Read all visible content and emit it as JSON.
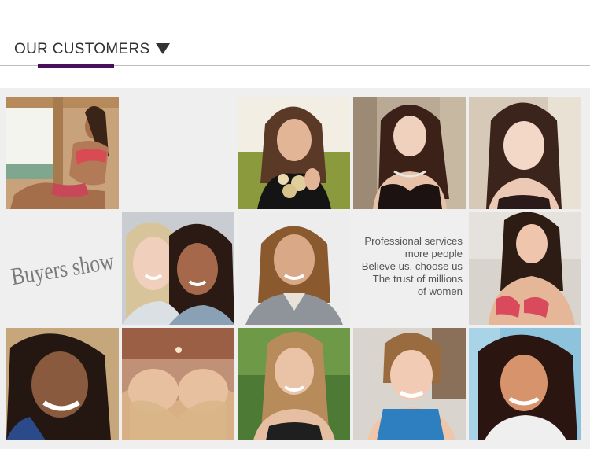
{
  "header": {
    "title": "OUR CUSTOMERS",
    "accent_color": "#4a0f5c"
  },
  "gallery": {
    "buyers_show": "Buyers show",
    "promo_lines": [
      "Professional services",
      "more people",
      "Believe us, choose us",
      "The trust of millions",
      "of women"
    ],
    "photos": [
      "customer-photo-1",
      "customer-photo-2",
      "customer-photo-3",
      "customer-photo-4",
      "customer-photo-5",
      "customer-photo-6",
      "customer-photo-7",
      "customer-photo-8",
      "customer-photo-9",
      "customer-photo-10",
      "customer-photo-11",
      "customer-photo-12"
    ]
  }
}
